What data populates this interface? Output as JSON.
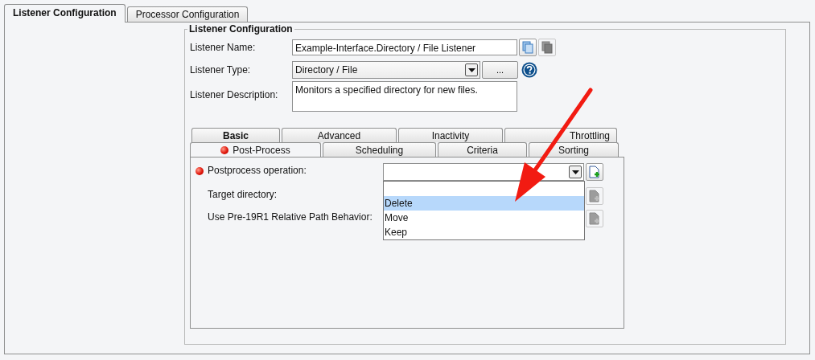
{
  "outer_tabs": [
    {
      "label": "Listener Configuration",
      "selected": true
    },
    {
      "label": "Processor Configuration",
      "selected": false
    }
  ],
  "group": {
    "title": "Listener Configuration",
    "name_field": {
      "label": "Listener Name:",
      "value": "Example-Interface.Directory / File Listener",
      "copy_buttons": [
        {
          "disabled": false
        },
        {
          "disabled": true
        }
      ]
    },
    "type_field": {
      "label": "Listener Type:",
      "value": "Directory / File",
      "browse_button": "..."
    },
    "description_field": {
      "label": "Listener Description:",
      "value": "Monitors a specified directory for new files."
    },
    "tab_rows": [
      [
        {
          "label": "Basic",
          "bold": true,
          "selected": false,
          "error": false
        },
        {
          "label": "Advanced",
          "bold": false,
          "selected": false,
          "error": false
        },
        {
          "label": "Inactivity",
          "bold": false,
          "selected": false,
          "error": false
        },
        {
          "label": "Throttling",
          "bold": false,
          "selected": false,
          "error": false
        }
      ],
      [
        {
          "label": "Post-Process",
          "bold": false,
          "selected": true,
          "error": true
        },
        {
          "label": "Scheduling",
          "bold": false,
          "selected": false,
          "error": false
        },
        {
          "label": "Criteria",
          "bold": false,
          "selected": false,
          "error": false
        },
        {
          "label": "Sorting",
          "bold": false,
          "selected": false,
          "error": false
        }
      ]
    ],
    "settings": [
      {
        "label": "Postprocess operation:",
        "error": true,
        "add_disabled": false
      },
      {
        "label": "Target directory:",
        "error": false,
        "add_disabled": true
      },
      {
        "label": "Use Pre-19R1 Relative Path Behavior:",
        "error": false,
        "add_disabled": true
      }
    ],
    "dropdown_options": [
      {
        "label": "Delete",
        "selected": true
      },
      {
        "label": "Move",
        "selected": false
      },
      {
        "label": "Keep",
        "selected": false
      }
    ]
  }
}
